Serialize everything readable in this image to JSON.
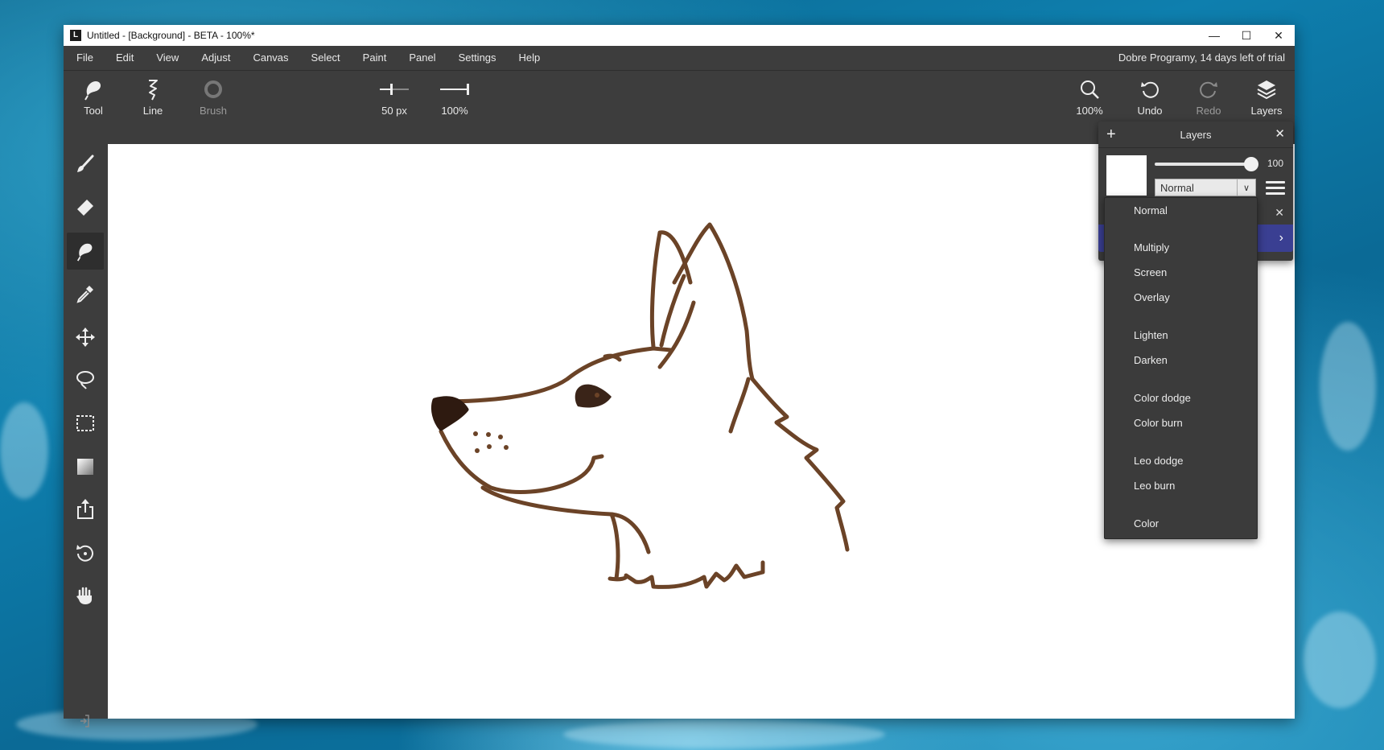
{
  "window": {
    "title": "Untitled - [Background] - BETA - 100%*",
    "app_icon": "L"
  },
  "window_controls": {
    "minimize": "—",
    "maximize": "☐",
    "close": "✕"
  },
  "menubar": {
    "items": [
      "File",
      "Edit",
      "View",
      "Adjust",
      "Canvas",
      "Select",
      "Paint",
      "Panel",
      "Settings",
      "Help"
    ],
    "trial_text": "Dobre Programy, 14 days left of trial"
  },
  "toolbar": {
    "tool": {
      "label": "Tool",
      "icon": "brush-tool-icon"
    },
    "line": {
      "label": "Line",
      "icon": "line-squiggle-icon"
    },
    "brush": {
      "label": "Brush",
      "icon": "brush-ring-icon"
    },
    "size": {
      "label": "50 px",
      "icon": "size-slider-icon"
    },
    "opacity": {
      "label": "100%",
      "icon": "opacity-slider-icon"
    },
    "zoom": {
      "label": "100%",
      "icon": "magnifier-icon"
    },
    "undo": {
      "label": "Undo",
      "icon": "undo-icon"
    },
    "redo": {
      "label": "Redo",
      "icon": "redo-icon"
    },
    "layers": {
      "label": "Layers",
      "icon": "layers-stack-icon"
    }
  },
  "left_tools": [
    "brush-icon",
    "eraser-icon",
    "smudge-icon",
    "eyedropper-icon",
    "move-icon",
    "lasso-icon",
    "marquee-icon",
    "gradient-icon",
    "export-icon",
    "rotate-icon",
    "hand-icon",
    "collapse-icon"
  ],
  "layers_panel": {
    "title": "Layers",
    "add": "+",
    "close": "✕",
    "opacity_value": "100",
    "opacity_level": 1.0,
    "blend_mode": "Normal",
    "row_close": "✕",
    "row_chevron": "›"
  },
  "blend_dropdown": {
    "options": [
      "Normal",
      "Multiply",
      "Screen",
      "Overlay",
      "Lighten",
      "Darken",
      "Color dodge",
      "Color burn",
      "Leo dodge",
      "Leo burn",
      "Color"
    ]
  },
  "colors": {
    "chrome": "#3d3d3d",
    "selected_layer": "#3a3f92",
    "stroke": "#6b4327",
    "nose": "#2e1a10"
  }
}
